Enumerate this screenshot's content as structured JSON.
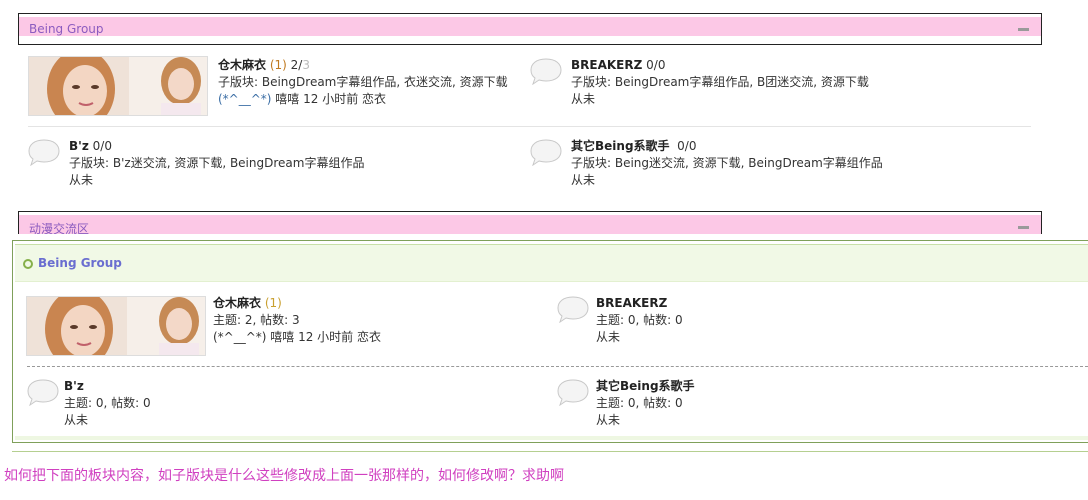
{
  "top": {
    "category_title": "Being Group",
    "next_category_title": "动漫交流区",
    "forums": {
      "kuraki": {
        "name": "仓木麻衣",
        "count_new": "(1)",
        "count_main": "2/",
        "count_grey": "3",
        "subforums": "子版块: BeingDream字幕组作品, 衣迷交流, 资源下载",
        "last_emote": "(*^__^*)",
        "last_post": " 嘻嘻  12 小时前  恋衣"
      },
      "breakerz": {
        "name": "BREAKERZ",
        "count_main": " 0/",
        "count_grey": "0",
        "subforums": "子版块: BeingDream字幕组作品, B团迷交流, 资源下载",
        "last_post": "从未"
      },
      "bz": {
        "name": "B'z",
        "count_main": " 0/",
        "count_grey": "0",
        "subforums": "子版块: B'z迷交流, 资源下载, BeingDream字幕组作品",
        "last_post": "从未"
      },
      "other": {
        "name": "其它Being系歌手",
        "count_main": "  0/",
        "count_grey": "0",
        "subforums": "子版块: Being迷交流, 资源下载, BeingDream字幕组作品",
        "last_post": "从未"
      }
    }
  },
  "bottom": {
    "category_title": "Being Group",
    "forums": {
      "kuraki": {
        "name": "仓木麻衣",
        "count_new": " (1)",
        "stats": "主题: 2, 帖数: 3",
        "last_post": "(*^__^*) 嘻嘻  12 小时前  恋衣"
      },
      "breakerz": {
        "name": "BREAKERZ",
        "stats": "主题: 0, 帖数: 0",
        "last_post": "从未"
      },
      "bz": {
        "name": "B'z",
        "stats": "主题: 0, 帖数: 0",
        "last_post": "从未"
      },
      "other": {
        "name": "其它Being系歌手",
        "stats": "主题: 0, 帖数: 0",
        "last_post": "从未"
      }
    }
  },
  "question": "如何把下面的板块内容，如子版块是什么这些修改成上面一张那样的，如何修改啊？求助啊",
  "colors": {
    "pink_band": "#fcc8e6",
    "purple_title": "#8c5cc0",
    "green_border": "#7fa05a",
    "question_text": "#d040c0"
  },
  "icons": [
    "collapse-icon",
    "forum-speech-bubble-icon",
    "category-ring-icon"
  ]
}
